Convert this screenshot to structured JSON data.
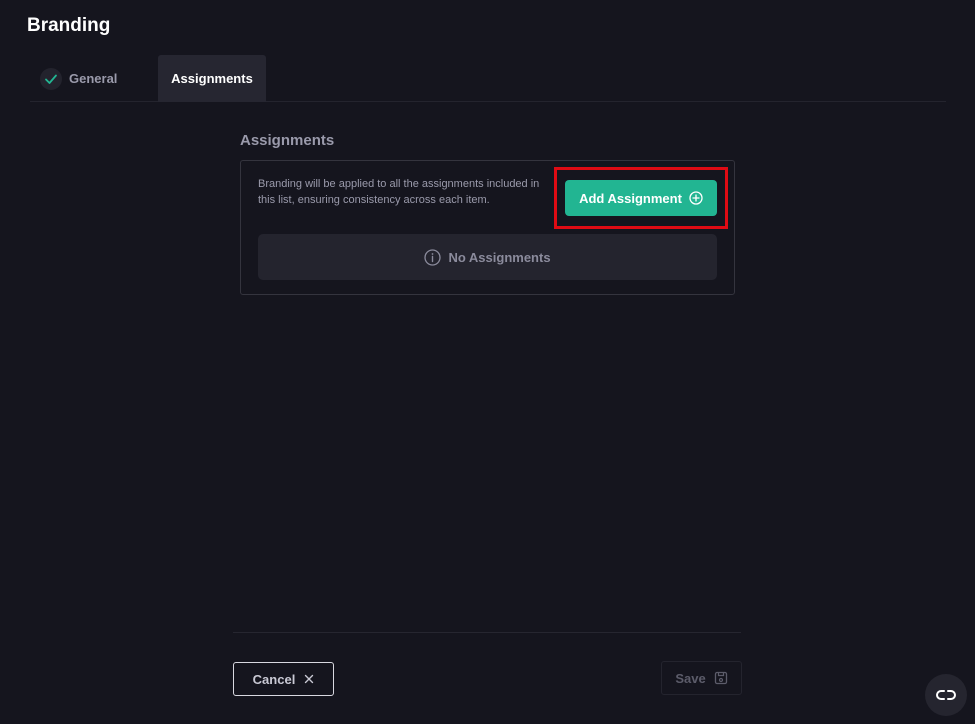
{
  "page": {
    "title": "Branding"
  },
  "tabs": [
    {
      "label": "General",
      "state": "completed"
    },
    {
      "label": "Assignments",
      "state": "active"
    }
  ],
  "assignments": {
    "title": "Assignments",
    "description": "Branding will be applied to all the assignments included in this list, ensuring consistency across each item.",
    "add_button_label": "Add Assignment",
    "add_button_icon": "plus-circle-icon",
    "empty_text": "No Assignments",
    "empty_icon": "info-icon"
  },
  "footer": {
    "cancel_label": "Cancel",
    "cancel_icon": "close-icon",
    "save_label": "Save",
    "save_icon": "save-icon"
  },
  "colors": {
    "background": "#15151e",
    "accent": "#22b592",
    "highlight": "#e00b14",
    "panel": "#24242e"
  },
  "widgets": {
    "chat_icon": "chat-link-icon"
  }
}
